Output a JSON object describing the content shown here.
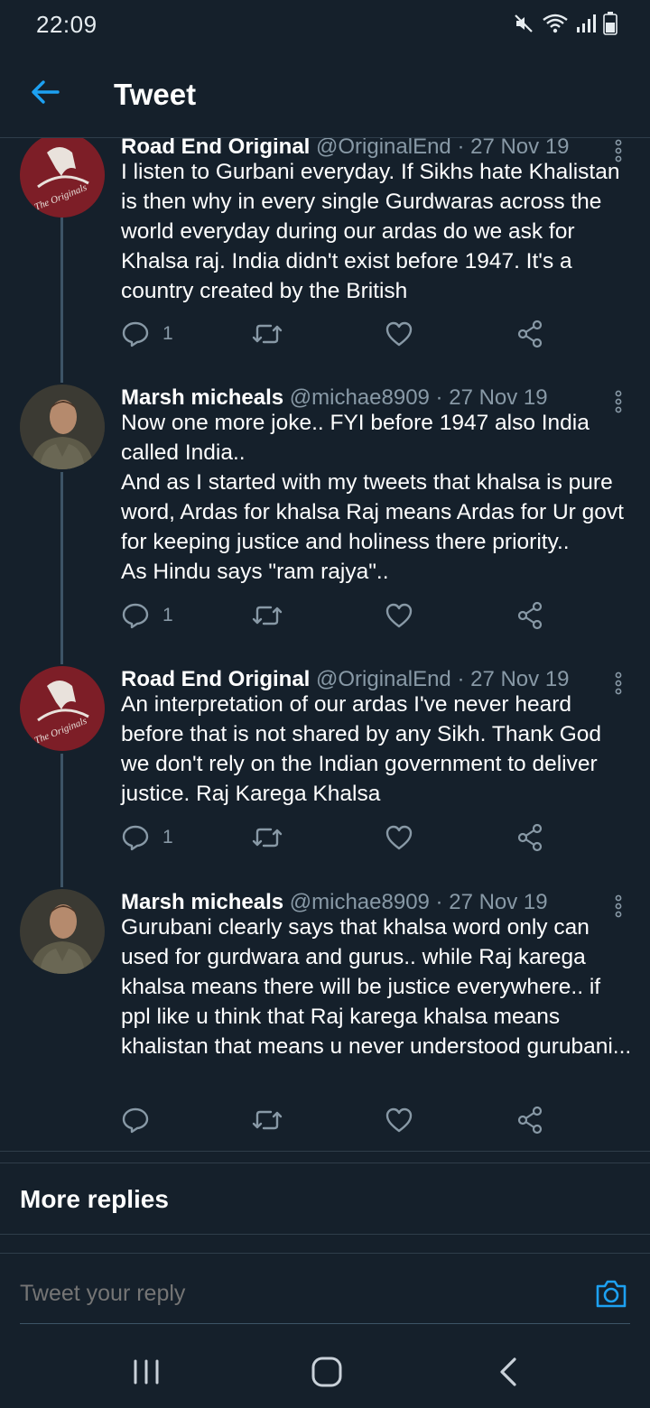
{
  "status_bar": {
    "time": "22:09"
  },
  "header": {
    "title": "Tweet"
  },
  "tweets": [
    {
      "name": "Road End Original",
      "handle": "@OriginalEnd · 27 Nov 19",
      "text": "I listen to Gurbani everyday. If Sikhs hate Khalistan is then why in every single Gurdwaras across the world everyday during our ardas do we ask for Khalsa raj. India didn't exist before 1947. It's a country created by the British",
      "reply_count": "1",
      "avatar_text": "The Originals"
    },
    {
      "name": "Marsh micheals",
      "handle": "@michae8909 · 27 Nov 19",
      "text": "Now one more joke.. FYI before 1947 also India called India..\nAnd as I started with my tweets that khalsa is pure word, Ardas for khalsa Raj means Ardas for Ur govt for keeping justice and holiness there priority..\nAs Hindu says \"ram rajya\"..",
      "reply_count": "1"
    },
    {
      "name": "Road End Original",
      "handle": "@OriginalEnd · 27 Nov 19",
      "text": "An interpretation of our ardas I've never heard before that is not shared by any Sikh. Thank God we don't rely on the Indian government to deliver justice. Raj Karega Khalsa",
      "reply_count": "1",
      "avatar_text": "The Originals"
    },
    {
      "name": "Marsh micheals",
      "handle": "@michae8909 · 27 Nov 19",
      "text": "Gurubani clearly says that khalsa word only can used for gurdwara and gurus.. while Raj karega khalsa means there will be justice everywhere.. if ppl like u think that Raj karega khalsa means khalistan that means u never understood gurubani...",
      "reply_count": ""
    }
  ],
  "more_replies": {
    "label": "More replies"
  },
  "reply_bar": {
    "placeholder": "Tweet your reply"
  },
  "colors": {
    "background": "#15202b",
    "accent": "#1da1f2",
    "secondary_text": "#8899a6",
    "divider": "#2f3d4a"
  },
  "icons": [
    "mute-icon",
    "wifi-icon",
    "signal-icon",
    "battery-icon",
    "back-arrow-icon",
    "reply-icon",
    "retweet-icon",
    "like-icon",
    "share-icon",
    "more-options-icon",
    "camera-icon",
    "recent-apps-icon",
    "home-icon",
    "back-icon"
  ]
}
